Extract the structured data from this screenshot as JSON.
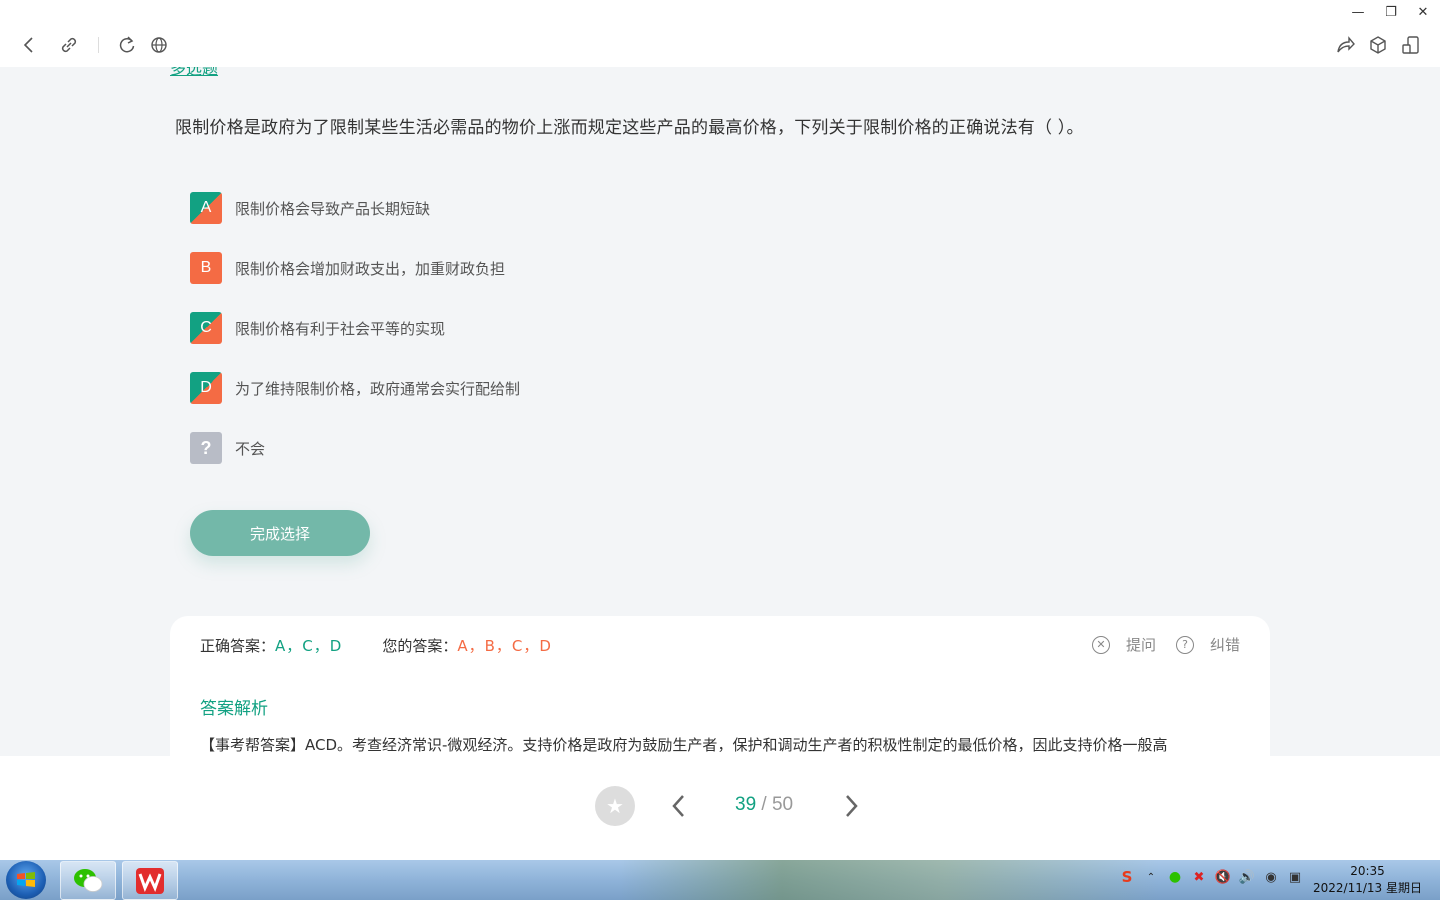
{
  "window_controls": {
    "minimize": "—",
    "restore": "❐",
    "close": "✕"
  },
  "toolbar": {
    "left_icons": [
      "back-icon",
      "link-icon",
      "refresh-icon",
      "globe-icon"
    ],
    "right_icons": [
      "share-icon",
      "cube-icon",
      "phone-icon"
    ]
  },
  "question": {
    "type_label": "多选题",
    "stem": "限制价格是政府为了限制某些生活必需品的物价上涨而规定这些产品的最高价格，下列关于限制价格的正确说法有（  ）。",
    "options": [
      {
        "letter": "A",
        "text": "限制价格会导致产品长期短缺"
      },
      {
        "letter": "B",
        "text": "限制价格会增加财政支出，加重财政负担"
      },
      {
        "letter": "C",
        "text": "限制价格有利于社会平等的实现"
      },
      {
        "letter": "D",
        "text": "为了维持限制价格，政府通常会实行配给制"
      },
      {
        "letter": "?",
        "text": "不会"
      }
    ],
    "submit_label": "完成选择"
  },
  "answer": {
    "correct_label": "正确答案：",
    "correct_value": "A，C，D",
    "yours_label": "您的答案：",
    "yours_value": "A，B，C，D",
    "ask_label": "提问",
    "correct_error_label": "纠错",
    "analysis_title": "答案解析",
    "analysis_text": "【事考帮答案】ACD。考查经济常识-微观经济。支持价格是政府为鼓励生产者，保护和调动生产者的积极性制定的最低价格，因此支持价格一般高"
  },
  "pager": {
    "current": "39",
    "separator": " / ",
    "total": "50"
  },
  "taskbar": {
    "apps": [
      "wechat-app",
      "wps-app"
    ],
    "time": "20:35",
    "date": "2022/11/13 星期日"
  },
  "colors": {
    "accent_green": "#12a182",
    "accent_orange": "#f46b44",
    "button_green": "#73b8a9"
  }
}
